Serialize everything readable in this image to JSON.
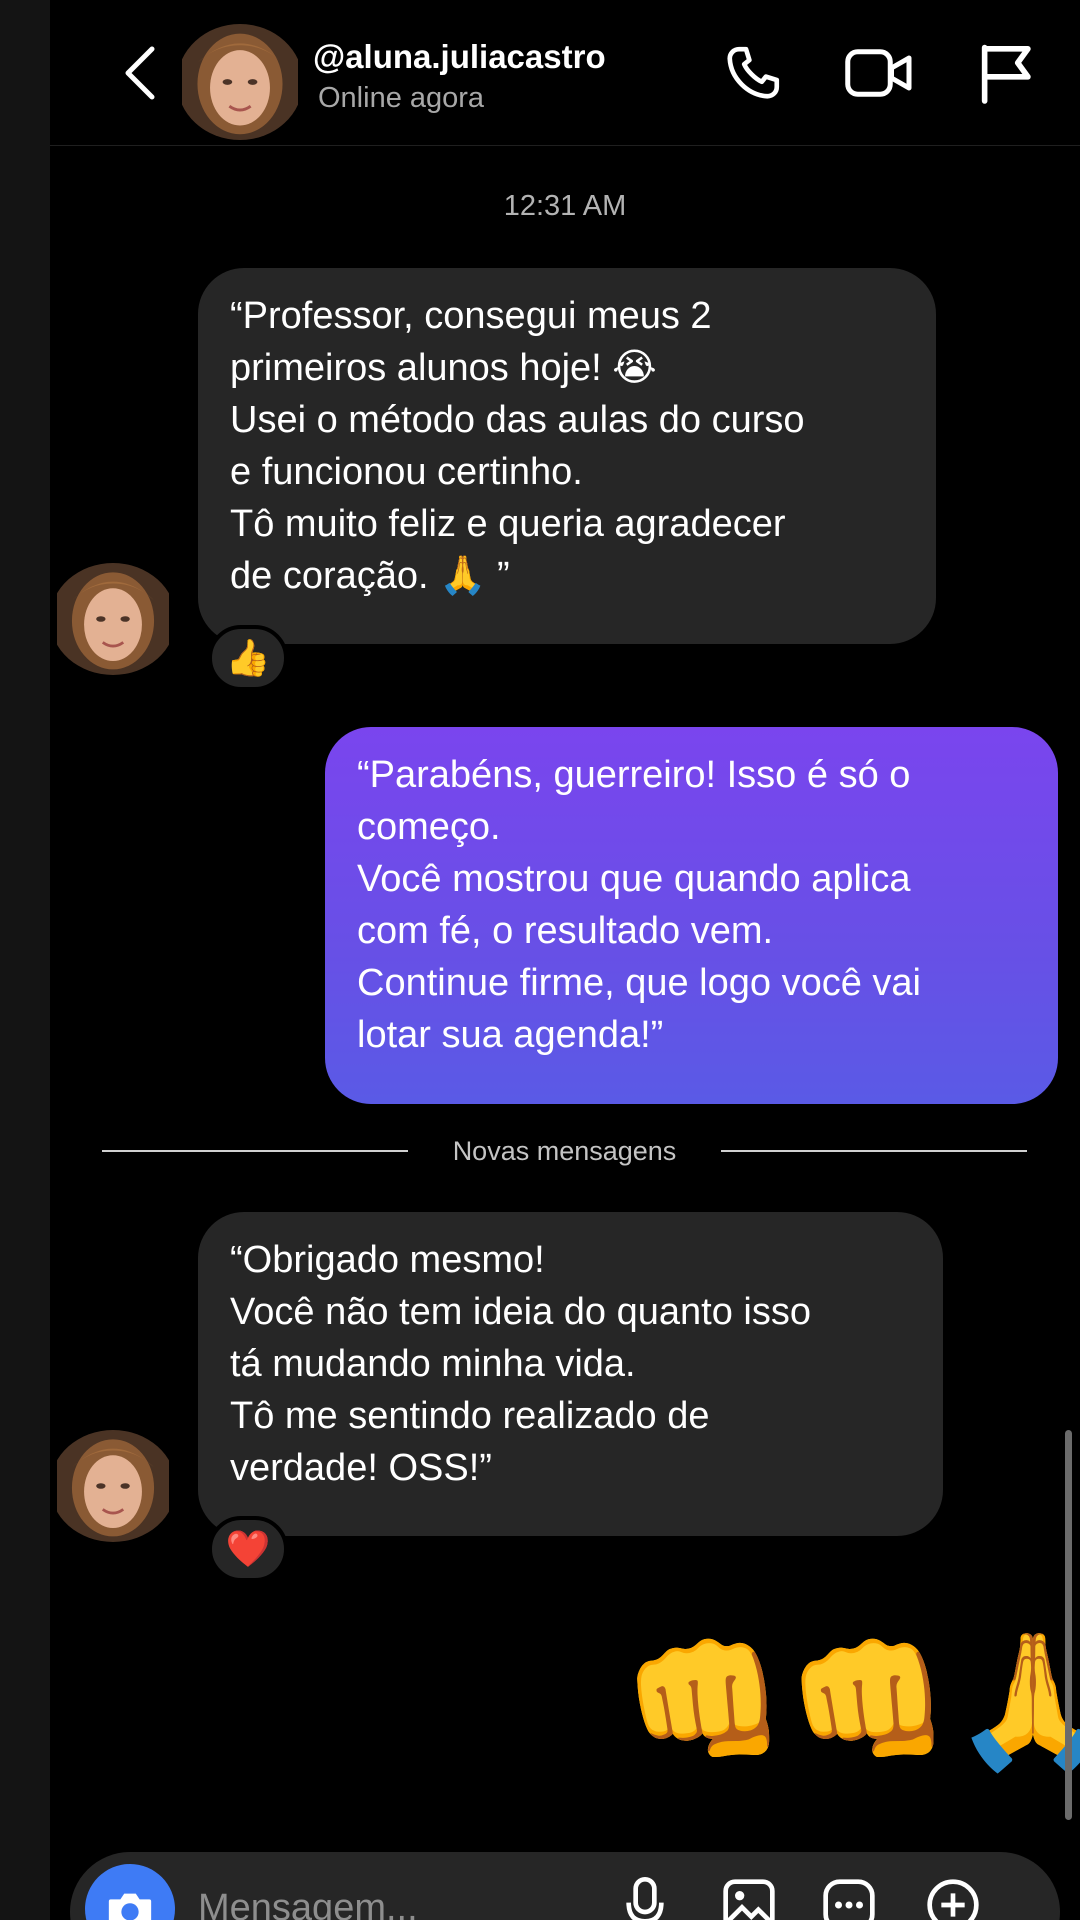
{
  "header": {
    "username": "@aluna.juliacastro",
    "status": "Online agora"
  },
  "chat": {
    "timestamp": "12:31 AM",
    "messages": [
      {
        "direction": "incoming",
        "text": "“Professor, consegui meus 2\nprimeiros alunos hoje! 😭\nUsei o método das aulas do curso\ne funcionou certinho.\nTô muito feliz e queria agradecer\nde coração. 🙏 ”",
        "reaction": "👍"
      },
      {
        "direction": "outgoing",
        "text": "“Parabéns, guerreiro! Isso é só o\ncomeço.\nVocê mostrou que quando aplica\ncom fé, o resultado vem.\nContinue firme, que logo você vai\nlotar sua agenda!”"
      },
      {
        "direction": "incoming",
        "text": "“Obrigado mesmo!\nVocê não tem ideia do quanto isso\ntá mudando minha vida.\nTô me sentindo realizado de\nverdade! OSS!”",
        "reaction": "❤️"
      },
      {
        "direction": "outgoing",
        "emojis": "👊👊🙏"
      }
    ],
    "new_messages_label": "Novas mensagens"
  },
  "composer": {
    "placeholder": "Mensagem..."
  },
  "icons": {
    "back": "chevron-left-icon",
    "call": "phone-icon",
    "video": "video-camera-icon",
    "report": "flag-icon",
    "camera": "camera-icon",
    "mic": "microphone-icon",
    "gallery": "image-icon",
    "sticker": "sticker-icon",
    "add": "plus-circle-icon"
  },
  "colors": {
    "outgoing_bubble": "#7a45ee",
    "incoming_bubble": "#262626",
    "camera_button": "#3e7bf5"
  }
}
